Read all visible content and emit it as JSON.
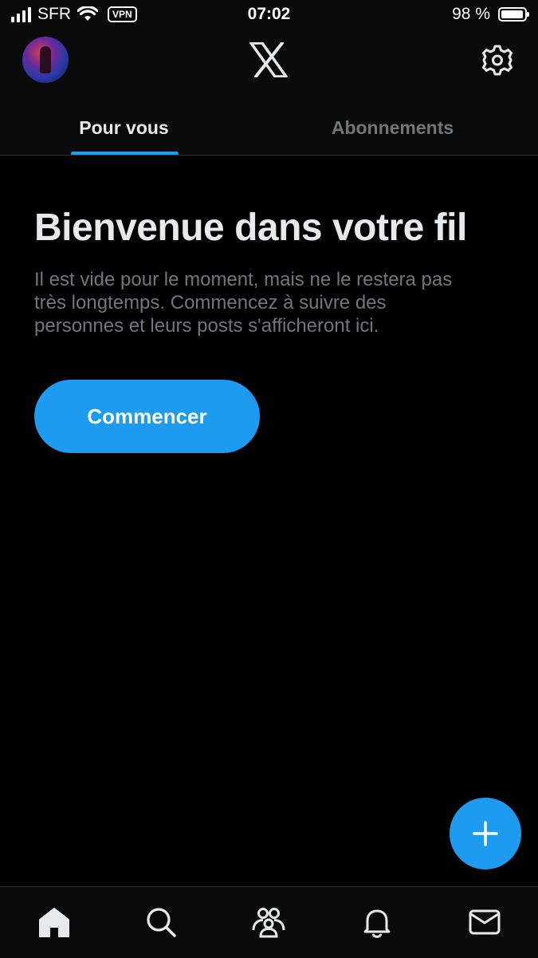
{
  "status_bar": {
    "carrier": "SFR",
    "vpn": "VPN",
    "time": "07:02",
    "battery": "98 %",
    "battery_level": 0.98,
    "icons": [
      "signal-icon",
      "wifi-icon",
      "battery-icon"
    ]
  },
  "header": {
    "logo": "x-logo-icon",
    "avatar": "avatar",
    "settings_icon": "gear-icon"
  },
  "tabs": [
    {
      "label": "Pour vous",
      "active": true
    },
    {
      "label": "Abonnements",
      "active": false
    }
  ],
  "empty_state": {
    "title": "Bienvenue dans votre fil",
    "subtitle_line1": "Il est vide pour le moment, mais ne le restera pas",
    "subtitle_line2": "très longtemps. Commencez à suivre des",
    "subtitle_line3": "personnes et leurs posts s'afficheront ici.",
    "cta_label": "Commencer"
  },
  "compose": {
    "icon": "plus-icon"
  },
  "bottom_nav": [
    {
      "icon": "home-icon",
      "active": true
    },
    {
      "icon": "search-icon",
      "active": false
    },
    {
      "icon": "communities-icon",
      "active": false
    },
    {
      "icon": "bell-icon",
      "active": false
    },
    {
      "icon": "mail-icon",
      "active": false
    }
  ],
  "colors": {
    "background": "#000000",
    "accent": "#1d9bf0",
    "text_primary": "#e7e9ea",
    "text_secondary": "#71767b",
    "divider": "#2f3336"
  }
}
